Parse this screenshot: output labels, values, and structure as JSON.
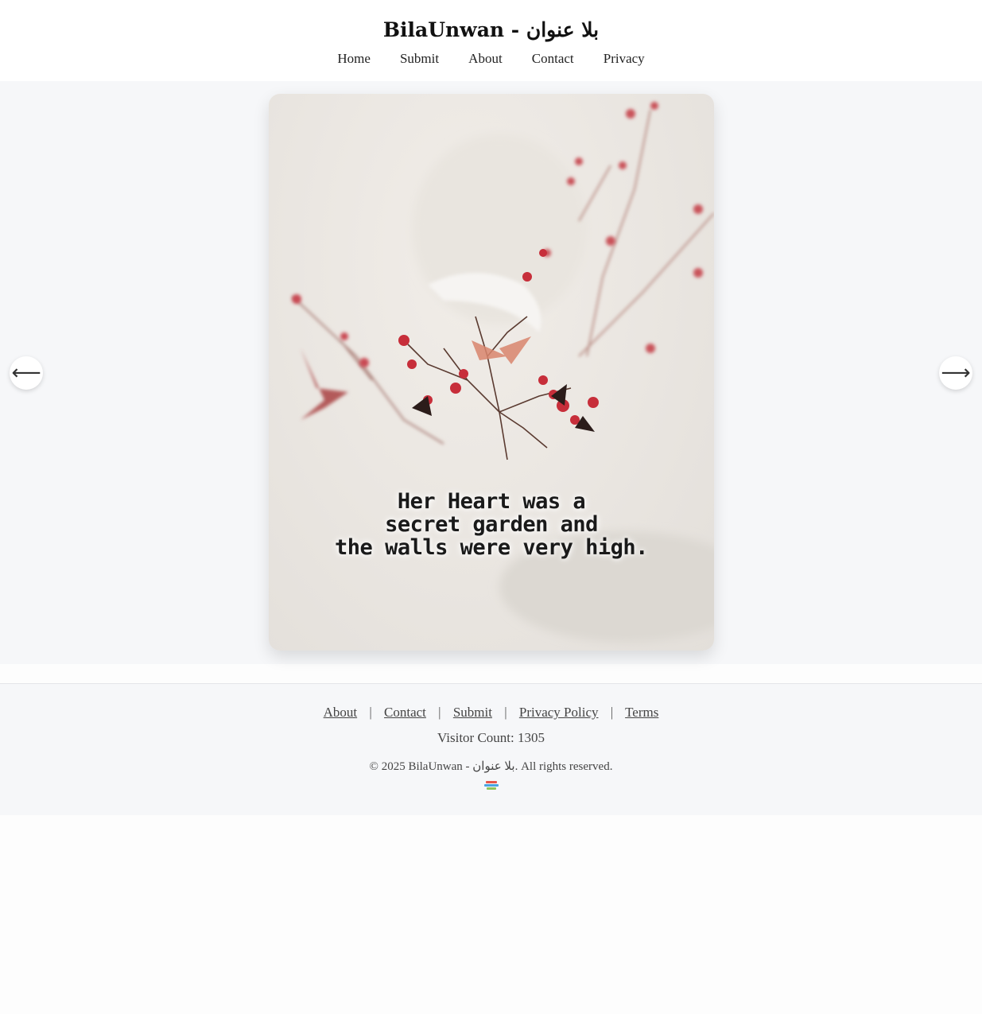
{
  "site": {
    "title": "BilaUnwan - بلا عنوان"
  },
  "nav": {
    "items": [
      "Home",
      "Submit",
      "About",
      "Contact",
      "Privacy"
    ]
  },
  "slide": {
    "quote_lines": [
      "Her Heart was a",
      "secret garden and",
      "the walls were very high."
    ]
  },
  "controls": {
    "prev_icon": "⟵",
    "next_icon": "⟶"
  },
  "footer": {
    "links": [
      "About",
      "Contact",
      "Submit",
      "Privacy Policy",
      "Terms"
    ],
    "separator": "|",
    "visitor_count": "Visitor Count: 1305",
    "copyright": "© 2025 BilaUnwan - بلا عنوان. All rights reserved."
  },
  "colors": {
    "page_bg": "#f6f7f9",
    "berry": "#c0303a",
    "text": "#222222"
  }
}
